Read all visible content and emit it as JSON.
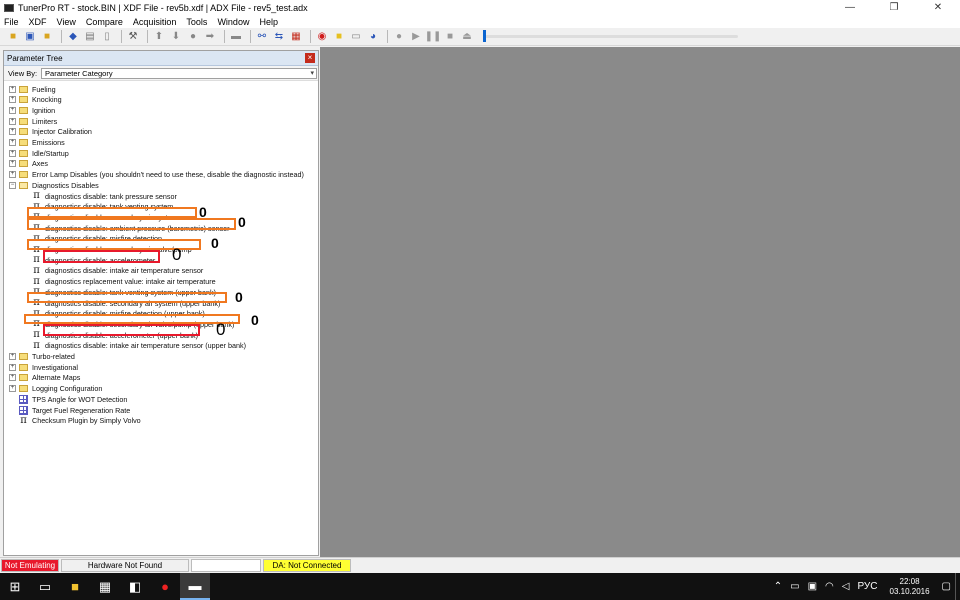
{
  "window": {
    "title": "TunerPro RT - stock.BIN | XDF File - rev5b.xdf | ADX File - rev5_test.adx",
    "minimize": "—",
    "maximize": "❐",
    "close": "✕"
  },
  "menu": [
    "File",
    "XDF",
    "View",
    "Compare",
    "Acquisition",
    "Tools",
    "Window",
    "Help"
  ],
  "panel": {
    "title": "Parameter Tree",
    "close": "×",
    "viewby_label": "View By:",
    "viewby_value": "Parameter Category"
  },
  "tree": [
    {
      "kind": "folder",
      "expander": "+",
      "label": "Fueling"
    },
    {
      "kind": "folder",
      "expander": "+",
      "label": "Knocking"
    },
    {
      "kind": "folder",
      "expander": "+",
      "label": "Ignition"
    },
    {
      "kind": "folder",
      "expander": "+",
      "label": "Limiters"
    },
    {
      "kind": "folder",
      "expander": "+",
      "label": "Injector Calibration"
    },
    {
      "kind": "folder",
      "expander": "+",
      "label": "Emissions"
    },
    {
      "kind": "folder",
      "expander": "+",
      "label": "Idle/Startup"
    },
    {
      "kind": "folder",
      "expander": "+",
      "label": "Axes"
    },
    {
      "kind": "folder",
      "expander": "+",
      "label": "Error Lamp Disables (you shouldn't need to use these, disable the diagnostic instead)"
    },
    {
      "kind": "folder-open",
      "expander": "−",
      "label": "Diagnostics Disables"
    },
    {
      "kind": "param",
      "label": "diagnostics disable: tank pressure sensor"
    },
    {
      "kind": "param",
      "label": "diagnostics disable: tank venting system"
    },
    {
      "kind": "param",
      "label": "diagnostics disable: secondary air system"
    },
    {
      "kind": "param",
      "label": "diagnostics disable: ambient pressure (barometric) sensor"
    },
    {
      "kind": "param",
      "label": "diagnostics disable: misfire detection"
    },
    {
      "kind": "param",
      "label": "diagnostics disable: secondary air valve/pump"
    },
    {
      "kind": "param",
      "label": "diagnostics disable: accelerometer"
    },
    {
      "kind": "param",
      "label": "diagnostics disable: intake air temperature sensor"
    },
    {
      "kind": "param",
      "label": "diagnostics replacement value: intake air temperature"
    },
    {
      "kind": "param",
      "label": "diagnostics disable: tank venting system (upper bank)"
    },
    {
      "kind": "param",
      "label": "diagnostics disable: secondary air system (upper bank)"
    },
    {
      "kind": "param",
      "label": "diagnostics disable: misfire detection (upper bank)"
    },
    {
      "kind": "param",
      "label": "diagnostics disable: secondary air valve/pump (upper bank)"
    },
    {
      "kind": "param",
      "label": "diagnostics disable: accelerometer (upper bank)"
    },
    {
      "kind": "param",
      "label": "diagnostics disable: intake air temperature sensor (upper bank)"
    },
    {
      "kind": "folder",
      "expander": "+",
      "label": "Turbo-related"
    },
    {
      "kind": "folder",
      "expander": "+",
      "label": "Investigational"
    },
    {
      "kind": "folder",
      "expander": "+",
      "label": "Alternate Maps"
    },
    {
      "kind": "folder",
      "expander": "+",
      "label": "Logging Configuration"
    },
    {
      "kind": "table",
      "label": "TPS Angle for WOT Detection"
    },
    {
      "kind": "table",
      "label": "Target Fuel Regeneration Rate"
    },
    {
      "kind": "param-root",
      "label": "Checksum Plugin by Simply Volvo"
    }
  ],
  "annotations": {
    "mark_bold": "0",
    "mark_thin": "0",
    "orange_color": "#f07820",
    "red_color": "#e8192c"
  },
  "status": {
    "emulating": "Not Emulating",
    "hardware": "Hardware Not Found",
    "da": "DA: Not Connected"
  },
  "taskbar": {
    "time": "22:08",
    "date": "03.10.2016",
    "lang": "РУС"
  }
}
